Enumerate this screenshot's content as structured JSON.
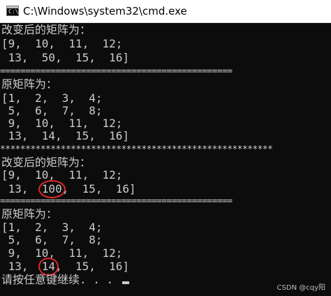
{
  "window": {
    "title": "C:\\Windows\\system32\\cmd.exe",
    "icon": "cmd-console-icon",
    "icon_glyph": "C:\\"
  },
  "console": {
    "lines": [
      "改变后的矩阵为：",
      "[9,  10,  11,  12;",
      " 13,  50,  15,  16]",
      "==============================================",
      "原矩阵为：",
      "[1,  2,  3,  4;",
      " 5,  6,  7,  8;",
      " 9,  10,  11,  12;",
      " 13,  14,  15,  16]",
      "******************************************************",
      "改变后的矩阵为：",
      "[9,  10,  11,  12;",
      {
        "before": " 13,  ",
        "highlight": "100",
        "after": ",  15,  16]"
      },
      "==============================================",
      "原矩阵为：",
      "[1,  2,  3,  4;",
      " 5,  6,  7,  8;",
      " 9,  10,  11,  12;",
      {
        "before": " 13,  ",
        "highlight": "14",
        "after": ",  15,  16]"
      },
      "请按任意键继续. . . "
    ]
  },
  "annotations": {
    "highlight_color": "#e0292b"
  },
  "watermark": "CSDN @cqy阳",
  "colors": {
    "console_bg": "#0c0c0c",
    "console_text": "#cccccc",
    "titlebar_bg": "#ffffff"
  }
}
